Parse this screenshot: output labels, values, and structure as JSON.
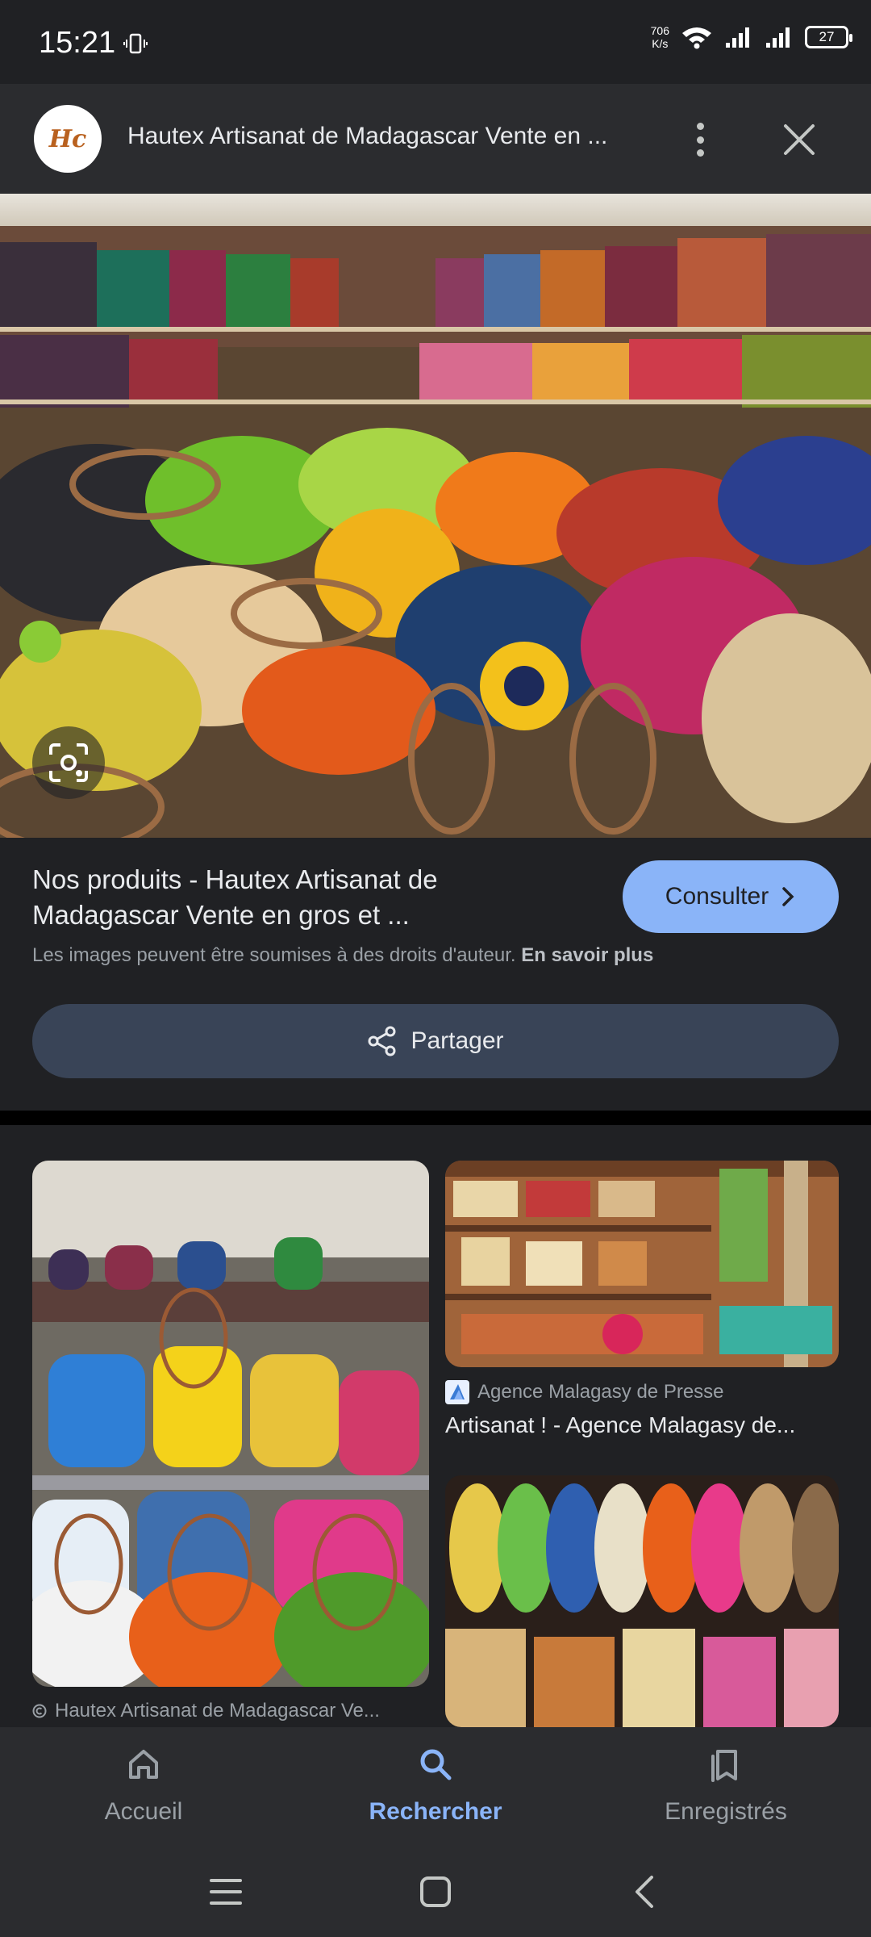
{
  "status_bar": {
    "time": "15:21",
    "net_speed_value": "706",
    "net_speed_unit": "K/s",
    "battery": "27"
  },
  "header": {
    "logo_text": "Hc",
    "title": "Hautex Artisanat de Madagascar Vente en ..."
  },
  "result": {
    "title": "Nos produits - Hautex Artisanat de Madagascar Vente en gros et ...",
    "consult_label": "Consulter",
    "copyright": "Les images peuvent être soumises à des droits d'auteur.",
    "learn_more": "En savoir plus",
    "share_label": "Partager"
  },
  "related": [
    {
      "source": "Hautex Artisanat de Madagascar Ve..."
    },
    {
      "source": "Agence Malagasy de Presse",
      "title": "Artisanat ! - Agence Malagasy de..."
    }
  ],
  "bottom_nav": [
    {
      "label": "Accueil",
      "icon": "home-icon"
    },
    {
      "label": "Rechercher",
      "icon": "search-icon",
      "active": true
    },
    {
      "label": "Enregistrés",
      "icon": "bookmarks-icon"
    }
  ],
  "colors": {
    "accent": "#8ab4f8",
    "background": "#202124",
    "surface": "#2b2c2f"
  }
}
